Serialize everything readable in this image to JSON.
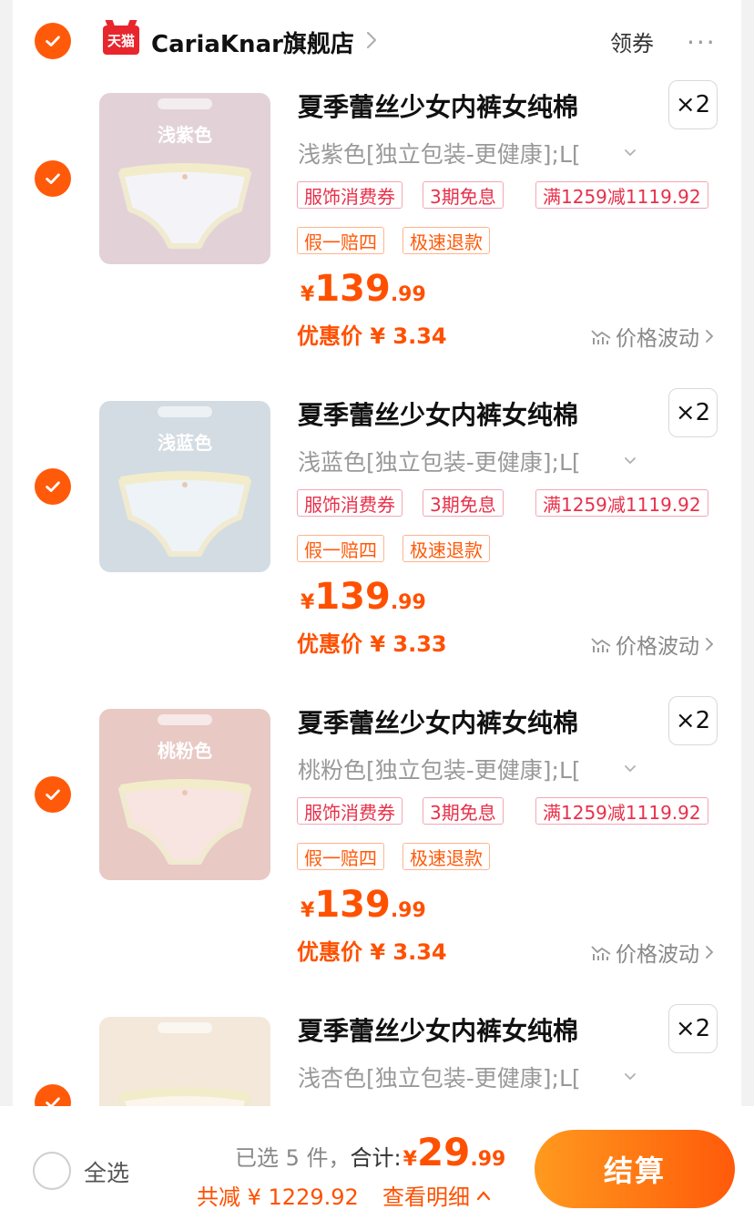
{
  "shop": {
    "logo_text": "天猫",
    "name": "CariaKnar旗舰店",
    "coupon_label": "领券",
    "more_label": "···"
  },
  "colors": {
    "accent": "#ff5a0a",
    "price": "#ff5000",
    "tag_red": "#e8304a",
    "tag_orange": "#ff5a0a"
  },
  "items": [
    {
      "thumb_label": "浅紫色",
      "thumb_color": "#e2d2d8",
      "title": "夏季蕾丝少女内裤女纯棉",
      "quantity": "×2",
      "sku": "浅紫色[独立包装-更健康];L[",
      "tags_red": [
        "服饰消费券",
        "3期免息",
        "满1259减1119.92"
      ],
      "tags_orange": [
        "假一赔四",
        "极速退款"
      ],
      "price_yen": "¥",
      "price_int": "139",
      "price_dec": ".99",
      "promo": "优惠价 ¥ 3.34",
      "trend_label": "价格波动"
    },
    {
      "thumb_label": "浅蓝色",
      "thumb_color": "#d3dce2",
      "title": "夏季蕾丝少女内裤女纯棉",
      "quantity": "×2",
      "sku": "浅蓝色[独立包装-更健康];L[",
      "tags_red": [
        "服饰消费券",
        "3期免息",
        "满1259减1119.92"
      ],
      "tags_orange": [
        "假一赔四",
        "极速退款"
      ],
      "price_yen": "¥",
      "price_int": "139",
      "price_dec": ".99",
      "promo": "优惠价 ¥ 3.33",
      "trend_label": "价格波动"
    },
    {
      "thumb_label": "桃粉色",
      "thumb_color": "#e8c9c4",
      "title": "夏季蕾丝少女内裤女纯棉",
      "quantity": "×2",
      "sku": "桃粉色[独立包装-更健康];L[",
      "tags_red": [
        "服饰消费券",
        "3期免息",
        "满1259减1119.92"
      ],
      "tags_orange": [
        "假一赔四",
        "极速退款"
      ],
      "price_yen": "¥",
      "price_int": "139",
      "price_dec": ".99",
      "promo": "优惠价 ¥ 3.34",
      "trend_label": "价格波动"
    },
    {
      "thumb_label": "",
      "thumb_color": "#f3e8da",
      "title": "夏季蕾丝少女内裤女纯棉",
      "quantity": "×2",
      "sku": "浅杏色[独立包装-更健康];L[",
      "tags_red": [],
      "tags_orange": [],
      "price_yen": "",
      "price_int": "",
      "price_dec": "",
      "promo": "",
      "trend_label": ""
    }
  ],
  "bottom": {
    "select_all": "全选",
    "selected_count": "已选 5 件，",
    "total_label": "合计:",
    "total_yen": "¥",
    "total_int": "29",
    "total_dec": ".99",
    "discount": "共减 ¥ 1229.92",
    "details": "查看明细",
    "checkout": "结算"
  }
}
